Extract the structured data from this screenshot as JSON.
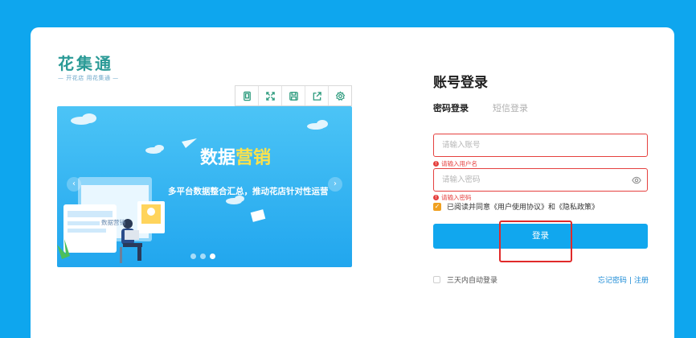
{
  "logo": {
    "title": "花集通",
    "subtitle": "— 开花店  用花集通 —"
  },
  "toolbar": {
    "icons": [
      "tablet-icon",
      "fullscreen-icon",
      "save-icon",
      "share-icon",
      "settings-icon"
    ]
  },
  "banner": {
    "title_plain": "数据",
    "title_highlight": "营销",
    "subtitle": "多平台数据整合汇总，推动花店针对性运营",
    "illustration_label": "数据营销",
    "prev": "‹",
    "next": "›"
  },
  "login": {
    "title": "账号登录",
    "tabs": {
      "active": "密码登录",
      "inactive": "短信登录"
    },
    "account": {
      "placeholder": "请输入账号",
      "error": "请输入用户名"
    },
    "password": {
      "placeholder": "请输入密码",
      "error": "请输入密码"
    },
    "agree_text": "已阅读并同意《用户使用协议》和《隐私政策》",
    "submit": "登录",
    "remember": "三天内自动登录",
    "forgot": "忘记密码",
    "separator": "|",
    "register": "注册"
  },
  "colors": {
    "brand": "#0ea6ee",
    "error": "#e5413f",
    "accent": "#ffe24a",
    "logo": "#2a9a96"
  }
}
